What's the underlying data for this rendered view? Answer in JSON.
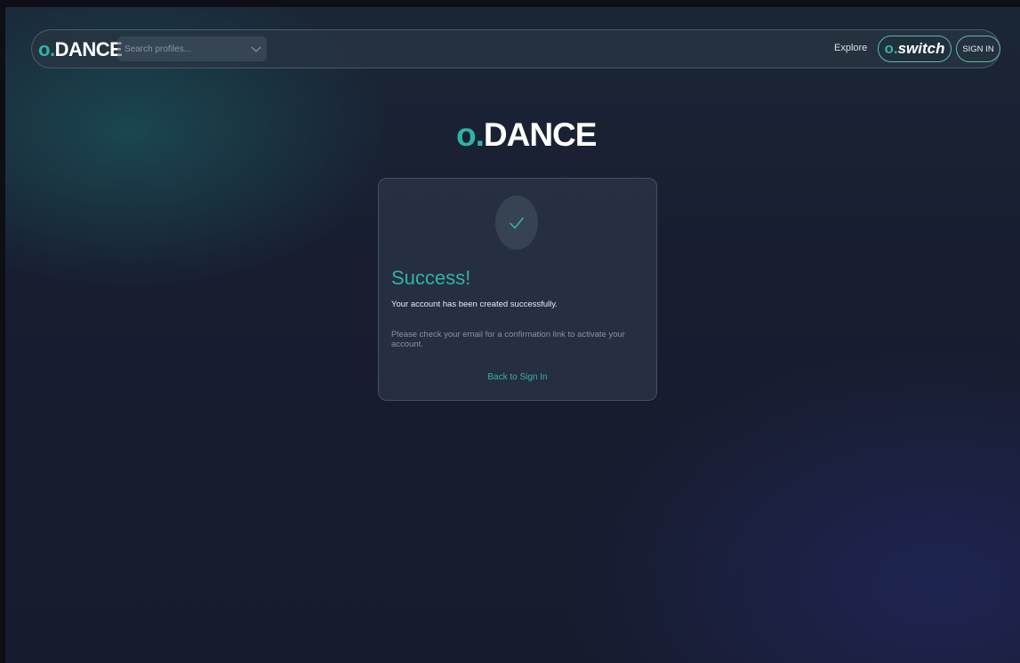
{
  "colors": {
    "accent": "#2fb3a8",
    "background": "#171b2e",
    "card": "#2d3448",
    "text_primary": "#e6ebf0",
    "text_muted": "#8792a2"
  },
  "navbar": {
    "brand_prefix": "o",
    "brand_dot": ".",
    "brand_name": "DANCE",
    "search": {
      "placeholder": "Search profiles...",
      "value": "",
      "icon": "chevron-down-icon"
    },
    "explore_label": "Explore",
    "switch_button": {
      "prefix": "o.",
      "label": "switch"
    },
    "signin_label": "SIGN IN"
  },
  "main": {
    "logo_prefix": "o.",
    "logo_name": "DANCE",
    "card": {
      "icon": "check-icon",
      "title": "Success!",
      "subtitle": "Your account has been created successfully.",
      "note": "Please check your email for a confirmation link to activate your account.",
      "back_link": "Back to Sign In"
    }
  }
}
